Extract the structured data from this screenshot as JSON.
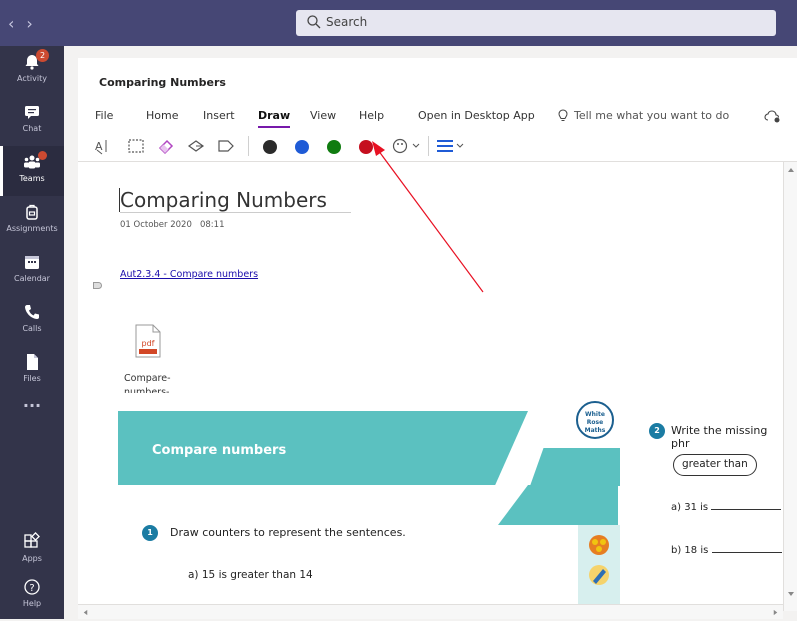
{
  "search": {
    "placeholder": "Search"
  },
  "rail": [
    {
      "label": "Activity",
      "icon": "bell-icon",
      "badge": "2"
    },
    {
      "label": "Chat",
      "icon": "chat-icon"
    },
    {
      "label": "Teams",
      "icon": "teams-icon",
      "badge_dot": true,
      "active": true
    },
    {
      "label": "Assignments",
      "icon": "backpack-icon"
    },
    {
      "label": "Calendar",
      "icon": "calendar-icon"
    },
    {
      "label": "Calls",
      "icon": "phone-icon"
    },
    {
      "label": "Files",
      "icon": "file-icon"
    },
    {
      "label": "...",
      "icon": "more-icon"
    },
    {
      "label": "Apps",
      "icon": "apps-icon"
    },
    {
      "label": "Help",
      "icon": "help-icon"
    }
  ],
  "header": {
    "title": "Comparing Numbers"
  },
  "menu": {
    "file": "File",
    "home": "Home",
    "insert": "Insert",
    "draw": "Draw",
    "view": "View",
    "help": "Help",
    "open_desktop": "Open in Desktop App",
    "tell_me": "Tell me what you want to do"
  },
  "toolbar": {
    "pen_colors": [
      "#2b2b2b",
      "#1f5bd6",
      "#107c10",
      "#c50f1f"
    ]
  },
  "note": {
    "title": "Comparing Numbers",
    "date": "01 October 2020",
    "time": "08:11",
    "link": "Aut2.3.4 - Compare numbers",
    "attachment_line1": "Compare-",
    "attachment_line2": "numbers-"
  },
  "worksheet": {
    "title": "Compare numbers",
    "logo": {
      "l1": "White",
      "l2": "Rose",
      "l3": "Maths"
    },
    "q1_num": "1",
    "q1_text": "Draw counters to represent the sentences.",
    "q1a": "a)  15 is greater than 14",
    "q2_num": "2",
    "q2_text": "Write the missing phr",
    "pill1": "greater than",
    "q2a": "a)  31 is",
    "q2b": "b)  18 is"
  },
  "colors": {
    "accent": "#7719aa",
    "rail": "#33344a",
    "topbar": "#464775",
    "banner": "#5bc1c0",
    "annotation": "#e81123"
  }
}
